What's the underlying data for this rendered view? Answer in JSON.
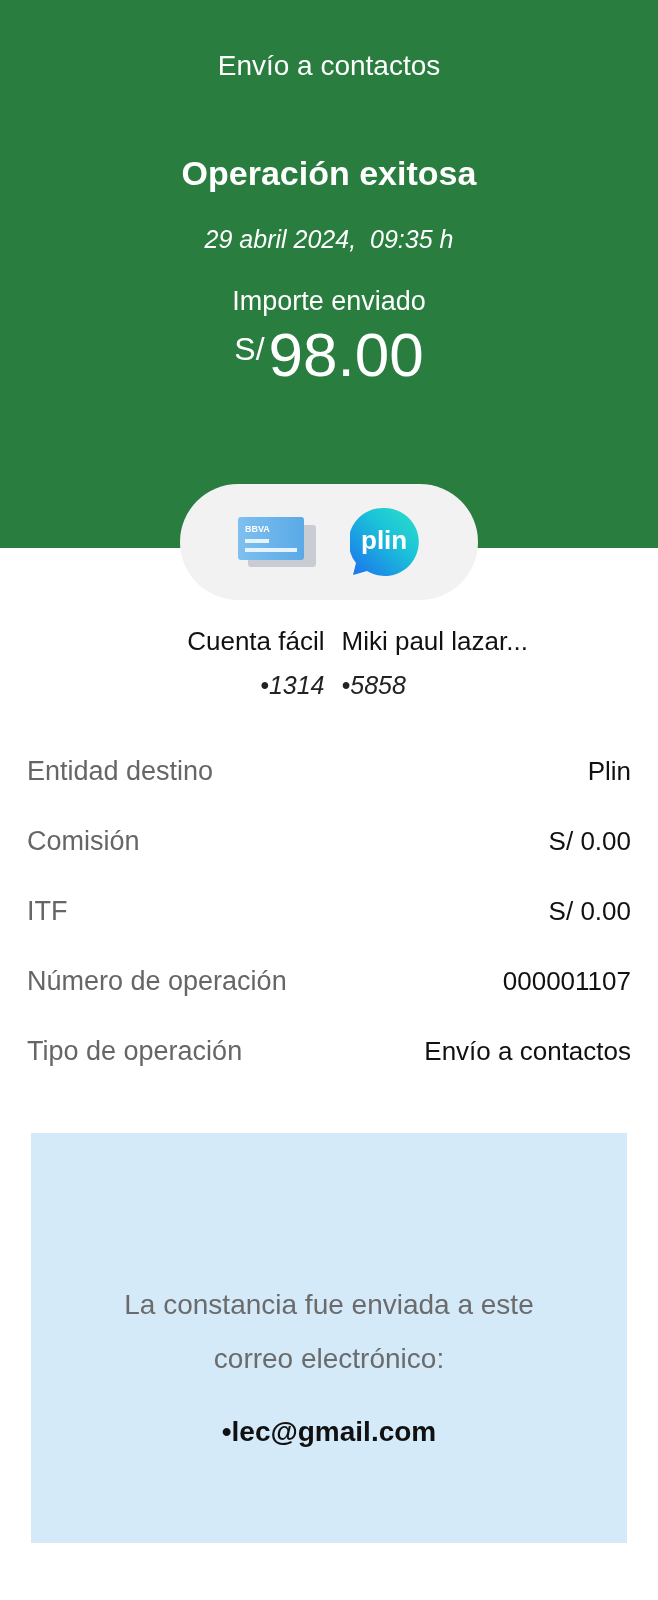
{
  "header": {
    "title": "Envío a contactos",
    "status": "Operación exitosa",
    "datetime": "29 abril 2024,  09:35 h",
    "amount_label": "Importe enviado",
    "currency": "S/",
    "amount": "98.00"
  },
  "transfer": {
    "from": {
      "logo_text": "BBVA",
      "name": "Cuenta fácil",
      "number": "•1314"
    },
    "to": {
      "logo_text": "plin",
      "name": "Miki paul lazar...",
      "number": "•5858"
    }
  },
  "details": [
    {
      "label": "Entidad destino",
      "value": "Plin"
    },
    {
      "label": "Comisión",
      "value": "S/ 0.00"
    },
    {
      "label": "ITF",
      "value": "S/ 0.00"
    },
    {
      "label": "Número de operación",
      "value": "000001107"
    },
    {
      "label": "Tipo de operación",
      "value": "Envío a contactos"
    }
  ],
  "notice": {
    "message": "La constancia fue enviada a este correo electrónico:",
    "email": "•lec@gmail.com"
  }
}
